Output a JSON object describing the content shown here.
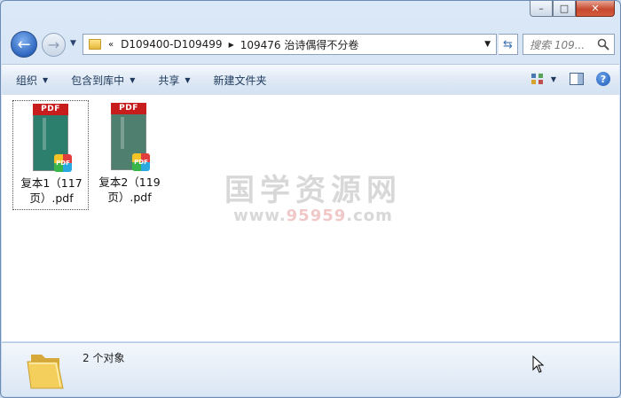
{
  "window": {
    "minimize": "–",
    "maximize": "□",
    "close": "✕"
  },
  "nav": {
    "back": "←",
    "forward": "→",
    "path_prefix": "«",
    "breadcrumb": [
      "D109400-D109499",
      "109476 治诗偶得不分卷"
    ],
    "search_placeholder": "搜索 109..."
  },
  "toolbar": {
    "organize": "组织",
    "include_library": "包含到库中",
    "share": "共享",
    "new_folder": "新建文件夹"
  },
  "files": [
    {
      "name": "复本1（117页）.pdf",
      "line1": "复本1（117",
      "line2": "页）.pdf",
      "cover_color": "#2c7f6d",
      "badge": "PDF"
    },
    {
      "name": "复本2（119页）.pdf",
      "line1": "复本2（119",
      "line2": "页）.pdf",
      "cover_color": "#4f7f6e",
      "badge": "PDF"
    }
  ],
  "thumb_label": "PDF",
  "watermark": {
    "text": "国学资源网",
    "url_a": "www.",
    "url_b": "95959",
    "url_c": ".com"
  },
  "status": {
    "count": "2 个对象"
  }
}
